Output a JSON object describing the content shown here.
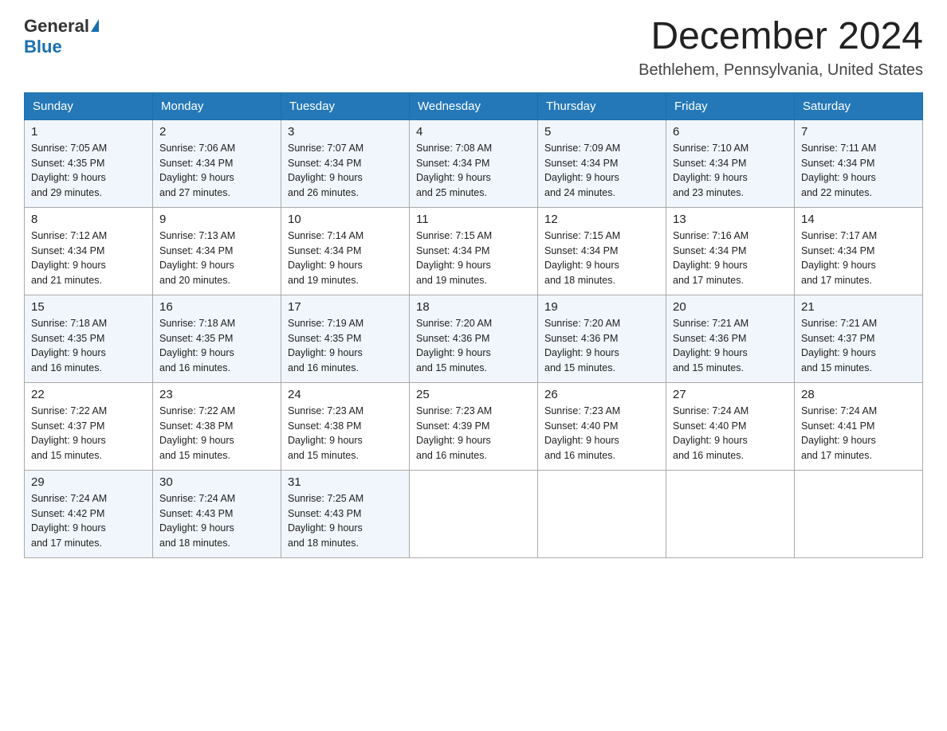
{
  "logo": {
    "general": "General",
    "blue": "Blue"
  },
  "title": "December 2024",
  "location": "Bethlehem, Pennsylvania, United States",
  "headers": [
    "Sunday",
    "Monday",
    "Tuesday",
    "Wednesday",
    "Thursday",
    "Friday",
    "Saturday"
  ],
  "weeks": [
    [
      {
        "num": "1",
        "sunrise": "7:05 AM",
        "sunset": "4:35 PM",
        "daylight": "9 hours and 29 minutes."
      },
      {
        "num": "2",
        "sunrise": "7:06 AM",
        "sunset": "4:34 PM",
        "daylight": "9 hours and 27 minutes."
      },
      {
        "num": "3",
        "sunrise": "7:07 AM",
        "sunset": "4:34 PM",
        "daylight": "9 hours and 26 minutes."
      },
      {
        "num": "4",
        "sunrise": "7:08 AM",
        "sunset": "4:34 PM",
        "daylight": "9 hours and 25 minutes."
      },
      {
        "num": "5",
        "sunrise": "7:09 AM",
        "sunset": "4:34 PM",
        "daylight": "9 hours and 24 minutes."
      },
      {
        "num": "6",
        "sunrise": "7:10 AM",
        "sunset": "4:34 PM",
        "daylight": "9 hours and 23 minutes."
      },
      {
        "num": "7",
        "sunrise": "7:11 AM",
        "sunset": "4:34 PM",
        "daylight": "9 hours and 22 minutes."
      }
    ],
    [
      {
        "num": "8",
        "sunrise": "7:12 AM",
        "sunset": "4:34 PM",
        "daylight": "9 hours and 21 minutes."
      },
      {
        "num": "9",
        "sunrise": "7:13 AM",
        "sunset": "4:34 PM",
        "daylight": "9 hours and 20 minutes."
      },
      {
        "num": "10",
        "sunrise": "7:14 AM",
        "sunset": "4:34 PM",
        "daylight": "9 hours and 19 minutes."
      },
      {
        "num": "11",
        "sunrise": "7:15 AM",
        "sunset": "4:34 PM",
        "daylight": "9 hours and 19 minutes."
      },
      {
        "num": "12",
        "sunrise": "7:15 AM",
        "sunset": "4:34 PM",
        "daylight": "9 hours and 18 minutes."
      },
      {
        "num": "13",
        "sunrise": "7:16 AM",
        "sunset": "4:34 PM",
        "daylight": "9 hours and 17 minutes."
      },
      {
        "num": "14",
        "sunrise": "7:17 AM",
        "sunset": "4:34 PM",
        "daylight": "9 hours and 17 minutes."
      }
    ],
    [
      {
        "num": "15",
        "sunrise": "7:18 AM",
        "sunset": "4:35 PM",
        "daylight": "9 hours and 16 minutes."
      },
      {
        "num": "16",
        "sunrise": "7:18 AM",
        "sunset": "4:35 PM",
        "daylight": "9 hours and 16 minutes."
      },
      {
        "num": "17",
        "sunrise": "7:19 AM",
        "sunset": "4:35 PM",
        "daylight": "9 hours and 16 minutes."
      },
      {
        "num": "18",
        "sunrise": "7:20 AM",
        "sunset": "4:36 PM",
        "daylight": "9 hours and 15 minutes."
      },
      {
        "num": "19",
        "sunrise": "7:20 AM",
        "sunset": "4:36 PM",
        "daylight": "9 hours and 15 minutes."
      },
      {
        "num": "20",
        "sunrise": "7:21 AM",
        "sunset": "4:36 PM",
        "daylight": "9 hours and 15 minutes."
      },
      {
        "num": "21",
        "sunrise": "7:21 AM",
        "sunset": "4:37 PM",
        "daylight": "9 hours and 15 minutes."
      }
    ],
    [
      {
        "num": "22",
        "sunrise": "7:22 AM",
        "sunset": "4:37 PM",
        "daylight": "9 hours and 15 minutes."
      },
      {
        "num": "23",
        "sunrise": "7:22 AM",
        "sunset": "4:38 PM",
        "daylight": "9 hours and 15 minutes."
      },
      {
        "num": "24",
        "sunrise": "7:23 AM",
        "sunset": "4:38 PM",
        "daylight": "9 hours and 15 minutes."
      },
      {
        "num": "25",
        "sunrise": "7:23 AM",
        "sunset": "4:39 PM",
        "daylight": "9 hours and 16 minutes."
      },
      {
        "num": "26",
        "sunrise": "7:23 AM",
        "sunset": "4:40 PM",
        "daylight": "9 hours and 16 minutes."
      },
      {
        "num": "27",
        "sunrise": "7:24 AM",
        "sunset": "4:40 PM",
        "daylight": "9 hours and 16 minutes."
      },
      {
        "num": "28",
        "sunrise": "7:24 AM",
        "sunset": "4:41 PM",
        "daylight": "9 hours and 17 minutes."
      }
    ],
    [
      {
        "num": "29",
        "sunrise": "7:24 AM",
        "sunset": "4:42 PM",
        "daylight": "9 hours and 17 minutes."
      },
      {
        "num": "30",
        "sunrise": "7:24 AM",
        "sunset": "4:43 PM",
        "daylight": "9 hours and 18 minutes."
      },
      {
        "num": "31",
        "sunrise": "7:25 AM",
        "sunset": "4:43 PM",
        "daylight": "9 hours and 18 minutes."
      },
      null,
      null,
      null,
      null
    ]
  ]
}
